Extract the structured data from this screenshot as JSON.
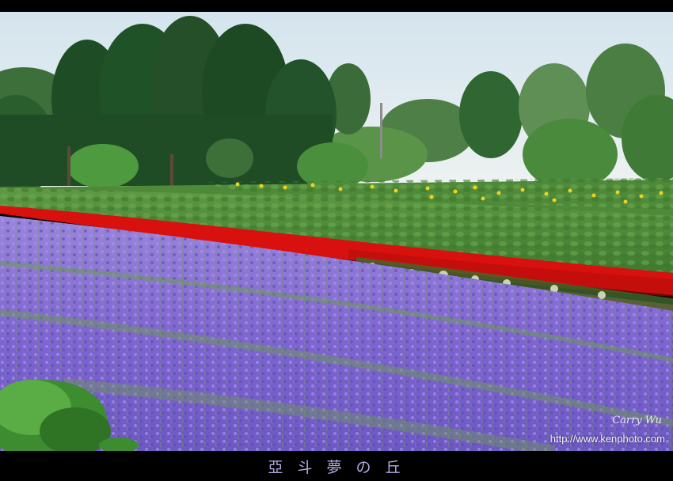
{
  "caption": "亞 斗 夢 の 丘",
  "signature": "Carry Wu",
  "watermark_url": "http://www.kenphoto.com",
  "colors": {
    "sky": "#dde8ef",
    "trees": "#245a2c",
    "field_green": "#4f8a3a",
    "sunflower_yellow": "#f0d21a",
    "salvia_red": "#e01010",
    "lavender": "#8a72d8",
    "caption_text": "#b9a8e6"
  }
}
